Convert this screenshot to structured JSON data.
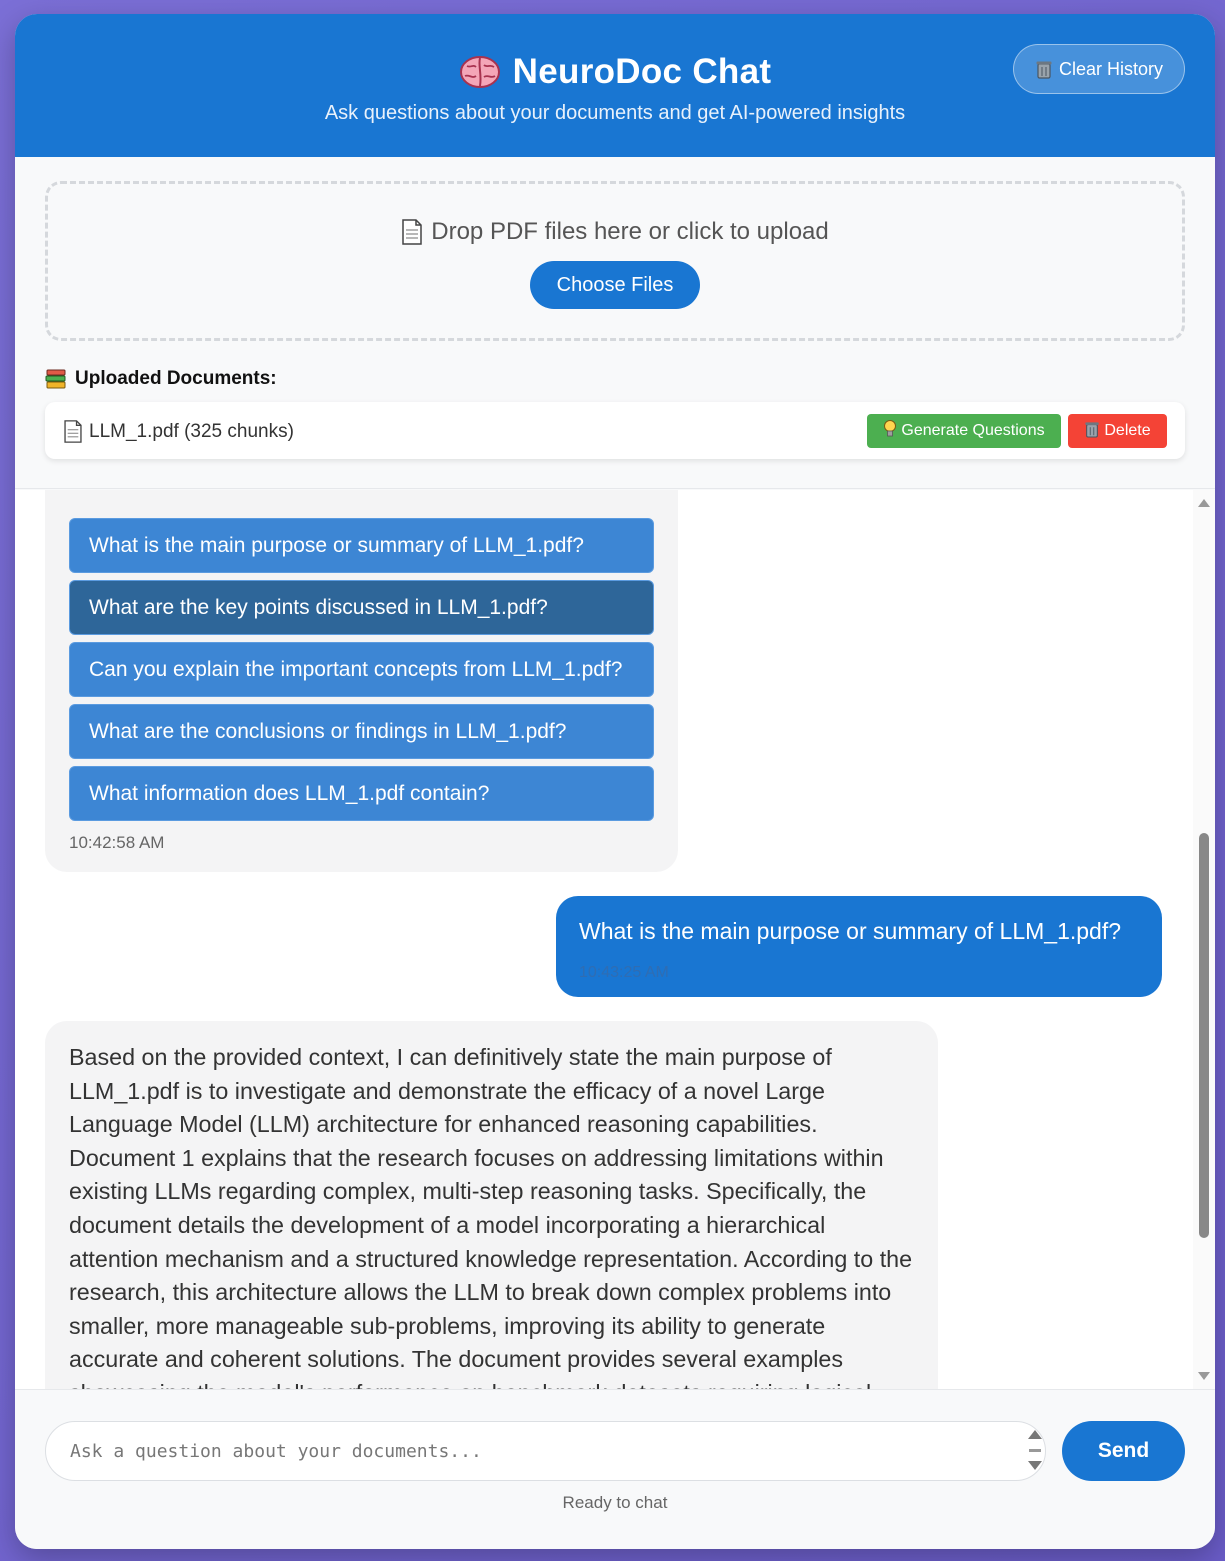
{
  "header": {
    "title": "NeuroDoc Chat",
    "subtitle": "Ask questions about your documents and get AI-powered insights",
    "title_icon": "brain-icon",
    "clear_label": "Clear History",
    "clear_icon": "trash-icon"
  },
  "upload": {
    "drop_text": "Drop PDF files here or click to upload",
    "drop_icon": "document-icon",
    "choose_label": "Choose Files"
  },
  "documents": {
    "heading": "Uploaded Documents:",
    "heading_icon": "books-icon",
    "items": [
      {
        "name": "LLM_1.pdf (325 chunks)",
        "generate_label": "Generate Questions",
        "generate_icon": "lightbulb-icon",
        "delete_label": "Delete",
        "delete_icon": "trash-icon"
      }
    ]
  },
  "chat": {
    "suggested_questions": [
      "What is the main purpose or summary of LLM_1.pdf?",
      "What are the key points discussed in LLM_1.pdf?",
      "Can you explain the important concepts from LLM_1.pdf?",
      "What are the conclusions or findings in LLM_1.pdf?",
      "What information does LLM_1.pdf contain?"
    ],
    "suggestions_time": "10:42:58 AM",
    "user_message": "What is the main purpose or summary of LLM_1.pdf?",
    "user_time": "10:43:25 AM",
    "bot_answer": "Based on the provided context, I can definitively state the main purpose of LLM_1.pdf is to investigate and demonstrate the efficacy of a novel Large Language Model (LLM) architecture for enhanced reasoning capabilities. Document 1 explains that the research focuses on addressing limitations within existing LLMs regarding complex, multi-step reasoning tasks. Specifically, the document details the development of a model incorporating a hierarchical attention mechanism and a structured knowledge representation. According to the research, this architecture allows the LLM to break down complex problems into smaller, more manageable sub-problems, improving its ability to generate accurate and coherent solutions. The document provides several examples showcasing the model's performance on benchmark datasets requiring logical"
  },
  "input": {
    "placeholder": "Ask a question about your documents...",
    "value": "",
    "send_label": "Send",
    "status": "Ready to chat"
  },
  "colors": {
    "primary": "#1976d2",
    "success": "#4caf50",
    "danger": "#f44336",
    "background": "#7b6fd6"
  }
}
